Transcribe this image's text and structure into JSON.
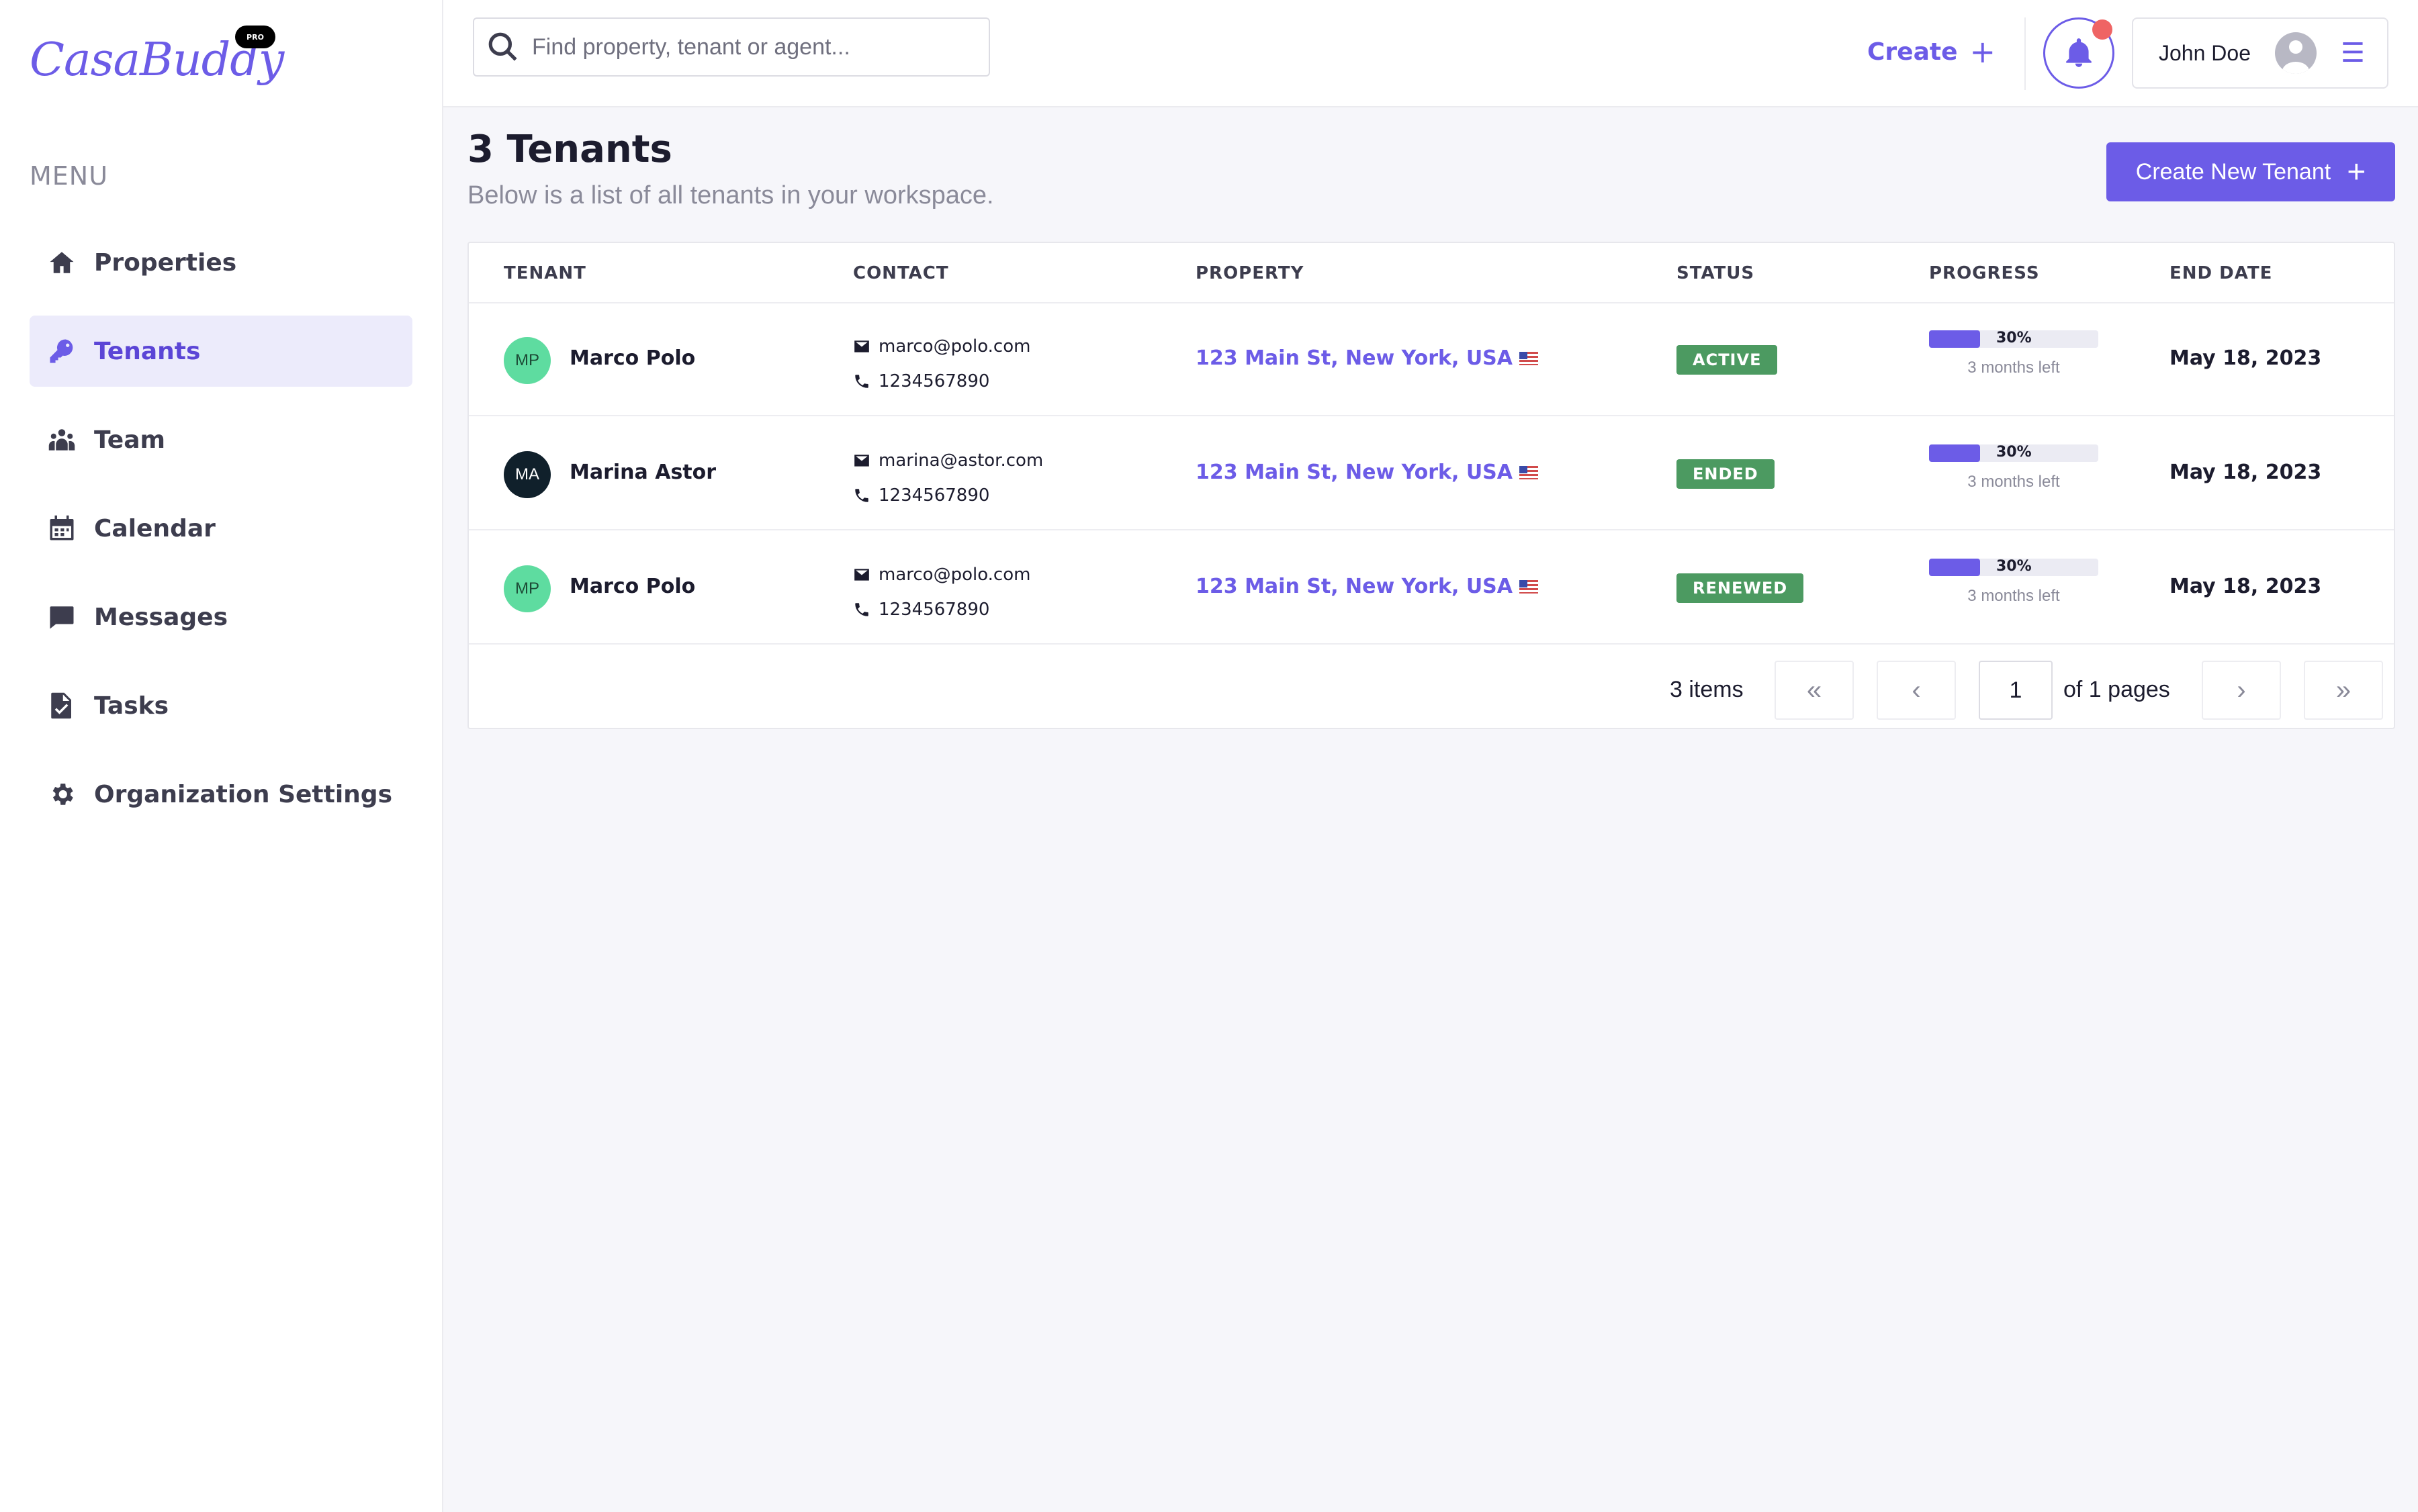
{
  "brand": {
    "logo": "CasaBuddy",
    "badge": "PRO"
  },
  "sidebar": {
    "menu_heading": "MENU",
    "items": [
      {
        "label": "Properties",
        "icon": "home-icon"
      },
      {
        "label": "Tenants",
        "icon": "key-icon",
        "active": true
      },
      {
        "label": "Team",
        "icon": "team-icon"
      },
      {
        "label": "Calendar",
        "icon": "calendar-icon"
      },
      {
        "label": "Messages",
        "icon": "message-icon"
      },
      {
        "label": "Tasks",
        "icon": "task-icon"
      },
      {
        "label": "Organization Settings",
        "icon": "gear-icon"
      }
    ]
  },
  "topbar": {
    "search_placeholder": "Find property, tenant or agent...",
    "create_label": "Create",
    "user_name": "John Doe"
  },
  "header": {
    "title": "3 Tenants",
    "subtitle": "Below is a list of all tenants in your workspace.",
    "create_button": "Create New Tenant"
  },
  "table": {
    "columns": [
      "TENANT",
      "CONTACT",
      "PROPERTY",
      "STATUS",
      "PROGRESS",
      "END DATE"
    ],
    "rows": [
      {
        "initials": "MP",
        "name": "Marco Polo",
        "email": "marco@polo.com",
        "phone": "1234567890",
        "property": "123 Main St, New York, USA",
        "status": "ACTIVE",
        "progress_label": "30%",
        "progress": 0.3,
        "progress_note": "3 months left",
        "end_date": "May 18, 2023"
      },
      {
        "initials": "MA",
        "name": "Marina Astor",
        "email": "marina@astor.com",
        "phone": "1234567890",
        "property": "123 Main St, New York, USA",
        "status": "ENDED",
        "progress_label": "30%",
        "progress": 0.3,
        "progress_note": "3 months left",
        "end_date": "May 18, 2023"
      },
      {
        "initials": "MP",
        "name": "Marco Polo",
        "email": "marco@polo.com",
        "phone": "1234567890",
        "property": "123 Main St, New York, USA",
        "status": "RENEWED",
        "progress_label": "30%",
        "progress": 0.3,
        "progress_note": "3 months left",
        "end_date": "May 18, 2023"
      }
    ]
  },
  "pagination": {
    "items_label": "3 items",
    "current_page": "1",
    "of_pages_label": "of 1 pages"
  },
  "colors": {
    "accent": "#6c5ce7",
    "status_green": "#4c9a61",
    "notification": "#ef6464"
  }
}
